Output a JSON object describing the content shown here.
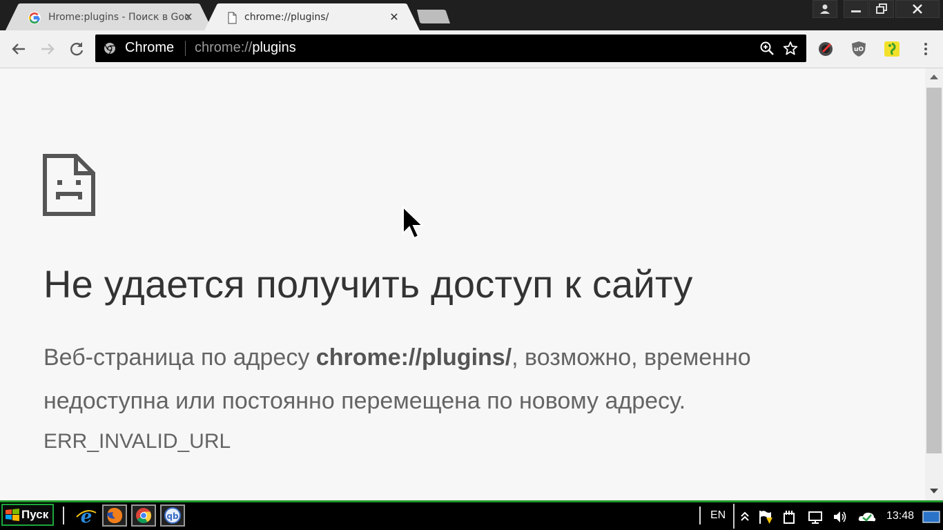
{
  "browser": {
    "tabs": [
      {
        "title": "Нrome:plugins - Поиск в Google",
        "active": false,
        "icon": "google-g-icon"
      },
      {
        "title": "chrome://plugins/",
        "active": true,
        "icon": "document-icon"
      }
    ],
    "omnibox": {
      "chip_label": "Chrome",
      "url_scheme": "chrome://",
      "url_host": "plugins"
    },
    "extensions": [
      "tampermonkey-like-icon",
      "ublock-icon",
      "bug-extension-icon"
    ]
  },
  "page": {
    "title": "Не удается получить доступ к сайту",
    "text_before": "Веб-страница по адресу ",
    "text_url": "chrome://plugins/",
    "text_after": ", возможно, временно недоступна или постоянно перемещена по новому адресу.",
    "error_code": "ERR_INVALID_URL"
  },
  "taskbar": {
    "start_label": "Пуск",
    "language": "EN",
    "time": "13:48",
    "accent_color": "#1f9a2a"
  }
}
